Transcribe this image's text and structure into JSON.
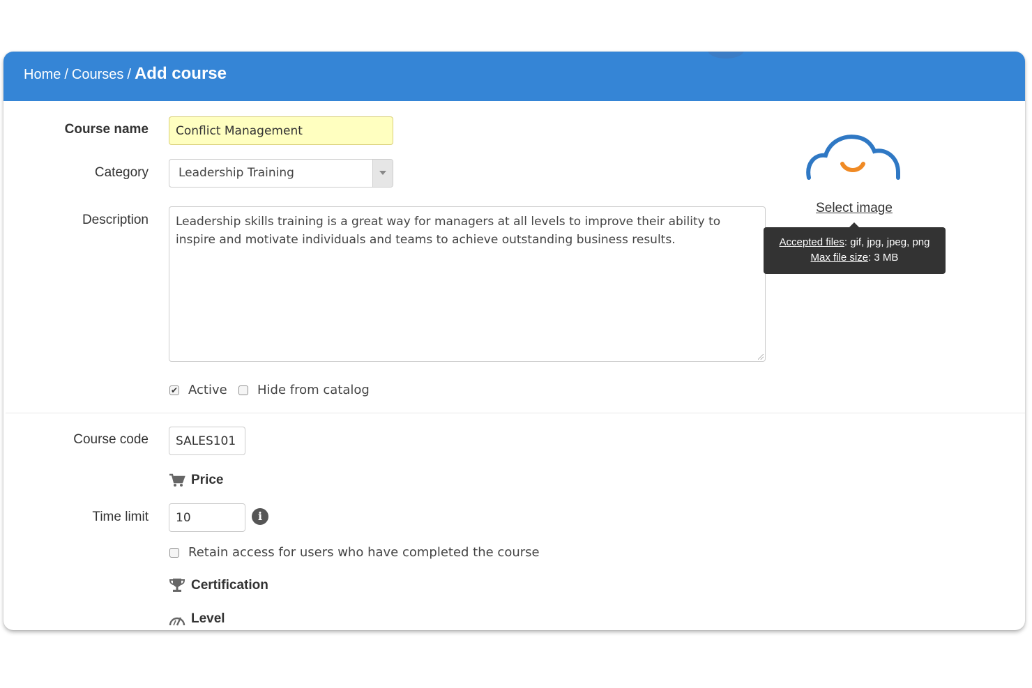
{
  "breadcrumb": {
    "home": "Home",
    "separator": "/",
    "courses": "Courses",
    "current": "Add course"
  },
  "form": {
    "course_name": {
      "label": "Course name",
      "value": "Conflict Management"
    },
    "category": {
      "label": "Category",
      "value": "Leadership Training"
    },
    "description": {
      "label": "Description",
      "value": "Leadership skills training is a great way for managers at all levels to improve their ability to inspire and motivate individuals and teams to achieve outstanding business results."
    },
    "active": {
      "label": "Active",
      "checked": true
    },
    "hide_from_catalog": {
      "label": "Hide from catalog",
      "checked": false
    },
    "course_code": {
      "label": "Course code",
      "value": "SALES101"
    },
    "price": {
      "label": "Price",
      "icon": "cart-icon"
    },
    "time_limit": {
      "label": "Time limit",
      "value": "10",
      "info_icon": "info-icon"
    },
    "retain_access": {
      "label": "Retain access for users who have completed the course",
      "checked": false
    },
    "certification": {
      "label": "Certification",
      "icon": "trophy-icon"
    },
    "level": {
      "label": "Level",
      "icon": "gauge-icon"
    }
  },
  "image_upload": {
    "icon": "cloud-smile-icon",
    "select_label": "Select image",
    "tooltip": {
      "accepted_label": "Accepted files",
      "accepted_value": ": gif, jpg, jpeg, png",
      "max_size_label": "Max file size",
      "max_size_value": ": 3 MB"
    }
  },
  "colors": {
    "header": "#3585d6",
    "highlight_input": "#ffffc0",
    "logo_blue": "#2f78c4",
    "logo_orange": "#f08a24",
    "tooltip_bg": "#333333"
  }
}
